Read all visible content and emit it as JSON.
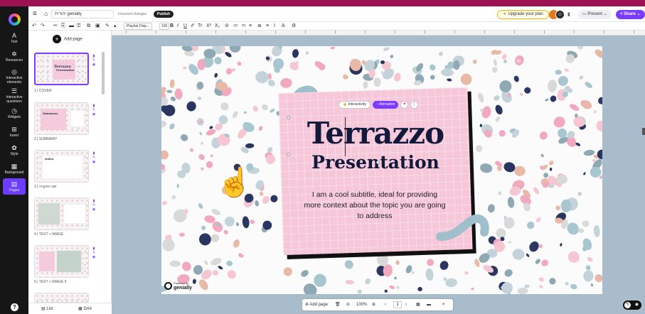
{
  "header": {
    "doc_title": "יהודית genially",
    "unsaved": "Unsaved changes",
    "publish": "Publish",
    "upgrade": "Upgrade your plan",
    "present": "Present",
    "share": "Share"
  },
  "rail": {
    "items": [
      {
        "label": "Text",
        "icon": "A"
      },
      {
        "label": "Resources",
        "icon": "✲"
      },
      {
        "label": "Interactive elements",
        "icon": "◎"
      },
      {
        "label": "Interactive questions",
        "icon": "☰"
      },
      {
        "label": "Widgets",
        "icon": "◷"
      },
      {
        "label": "Insert",
        "icon": "⊞"
      },
      {
        "label": "Style",
        "icon": "✿"
      },
      {
        "label": "Background",
        "icon": "▦"
      },
      {
        "label": "Pages",
        "icon": "▤"
      }
    ],
    "help": "?"
  },
  "toolbar": {
    "font": "Playfair Disp...",
    "size": "100"
  },
  "panel": {
    "add_page": "Add page",
    "pages": [
      {
        "label": "1 | COVER",
        "title": "Terrazzo Presentation"
      },
      {
        "label": "2 | SUMMARY",
        "title": "Summary"
      },
      {
        "label": "3 | שם האקציה",
        "title": "Index"
      },
      {
        "label": "4 | TEXT + IMAGE",
        "title": "Text + image"
      },
      {
        "label": "5 | TEXT + IMAGE II",
        "title": "Text + image"
      }
    ],
    "list": "List",
    "grid": "Grid"
  },
  "slide": {
    "title_line1": "Terrazzo",
    "title_line2": "Presentation",
    "subtitle": "I am a cool subtitle, ideal for providing more context about the topic you are going to address",
    "interactivity": "Interactivity",
    "animation": "Animation",
    "brand_small": "Powered by",
    "brand": "genially"
  },
  "bottombar": {
    "add_page": "Add page",
    "zoom": "100%",
    "page": "1"
  },
  "colors": {
    "accent": "#7b3cff",
    "top_strip": "#9b1152",
    "canvas_bg": "#a8bccb",
    "card_pink": "#f5c7d9",
    "title_navy": "#12193b"
  }
}
